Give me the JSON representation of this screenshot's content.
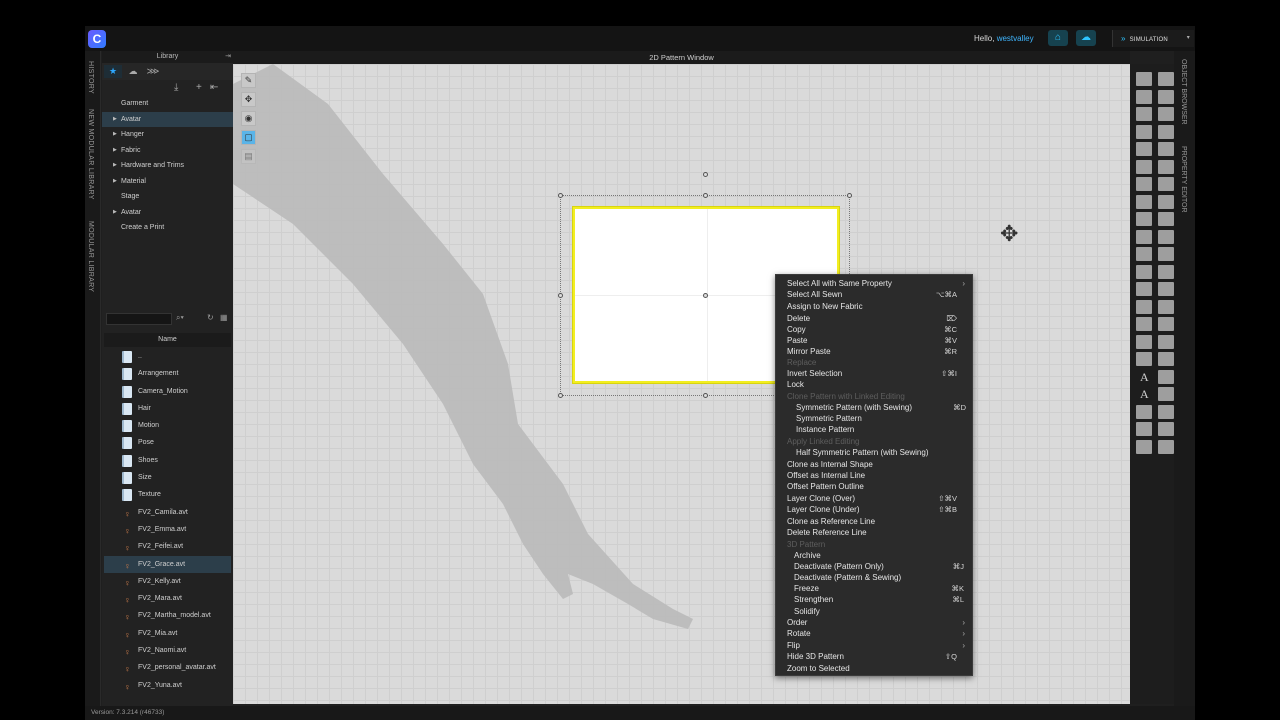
{
  "topbar": {
    "greeting": "Hello,",
    "username": "westvalley",
    "simulation_label": "SIMULATION"
  },
  "left_tabs": [
    "HISTORY",
    "NEW MODULAR LIBRARY",
    "MODULAR LIBRARY"
  ],
  "right_tabs": [
    "OBJECT BROWSER",
    "PROPERTY EDITOR"
  ],
  "library": {
    "title": "Library",
    "tree": [
      {
        "label": "Garment",
        "arrow": false,
        "selected": false
      },
      {
        "label": "Avatar",
        "arrow": true,
        "selected": true
      },
      {
        "label": "Hanger",
        "arrow": true,
        "selected": false
      },
      {
        "label": "Fabric",
        "arrow": true,
        "selected": false
      },
      {
        "label": "Hardware and Trims",
        "arrow": true,
        "selected": false
      },
      {
        "label": "Material",
        "arrow": true,
        "selected": false
      },
      {
        "label": "Stage",
        "arrow": false,
        "selected": false
      },
      {
        "label": "Avatar",
        "arrow": true,
        "selected": false
      },
      {
        "label": "Create a Print",
        "arrow": false,
        "selected": false
      }
    ],
    "column_header": "Name",
    "files": [
      {
        "name": "..",
        "type": "folder"
      },
      {
        "name": "Arrangement",
        "type": "folder"
      },
      {
        "name": "Camera_Motion",
        "type": "folder"
      },
      {
        "name": "Hair",
        "type": "folder"
      },
      {
        "name": "Motion",
        "type": "folder"
      },
      {
        "name": "Pose",
        "type": "folder"
      },
      {
        "name": "Shoes",
        "type": "folder"
      },
      {
        "name": "Size",
        "type": "folder"
      },
      {
        "name": "Texture",
        "type": "folder"
      },
      {
        "name": "FV2_Camila.avt",
        "type": "avatar"
      },
      {
        "name": "FV2_Emma.avt",
        "type": "avatar"
      },
      {
        "name": "FV2_Feifei.avt",
        "type": "avatar"
      },
      {
        "name": "FV2_Grace.avt",
        "type": "avatar",
        "selected": true
      },
      {
        "name": "FV2_Kelly.avt",
        "type": "avatar"
      },
      {
        "name": "FV2_Mara.avt",
        "type": "avatar"
      },
      {
        "name": "FV2_Martha_model.avt",
        "type": "avatar"
      },
      {
        "name": "FV2_Mia.avt",
        "type": "avatar"
      },
      {
        "name": "FV2_Naomi.avt",
        "type": "avatar"
      },
      {
        "name": "FV2_personal_avatar.avt",
        "type": "avatar"
      },
      {
        "name": "FV2_Yuna.avt",
        "type": "avatar"
      }
    ]
  },
  "window_title": "2D Pattern Window",
  "status": {
    "version": "Version: 7.3.214 (r46733)"
  },
  "context_menu": [
    {
      "label": "Select All with Same Property",
      "shortcut": "",
      "submenu": true,
      "disabled": false,
      "indent": 0
    },
    {
      "label": "Select All Sewn",
      "shortcut": "⌥⌘A",
      "submenu": false,
      "disabled": false,
      "indent": 0
    },
    {
      "label": "Assign to New Fabric",
      "shortcut": "",
      "submenu": false,
      "disabled": false,
      "indent": 0
    },
    {
      "label": "Delete",
      "shortcut": "⌦",
      "submenu": false,
      "disabled": false,
      "indent": 0
    },
    {
      "label": "Copy",
      "shortcut": "⌘C",
      "submenu": false,
      "disabled": false,
      "indent": 0
    },
    {
      "label": "Paste",
      "shortcut": "⌘V",
      "submenu": false,
      "disabled": false,
      "indent": 0
    },
    {
      "label": "Mirror Paste",
      "shortcut": "⌘R",
      "submenu": false,
      "disabled": false,
      "indent": 0
    },
    {
      "label": "Replace",
      "shortcut": "",
      "submenu": false,
      "disabled": true,
      "indent": 0
    },
    {
      "label": "Invert Selection",
      "shortcut": "⇧⌘I",
      "submenu": false,
      "disabled": false,
      "indent": 0
    },
    {
      "label": "Lock",
      "shortcut": "",
      "submenu": false,
      "disabled": false,
      "indent": 0
    },
    {
      "label": "Clone Pattern with Linked Editing",
      "shortcut": "",
      "submenu": false,
      "disabled": true,
      "indent": 0
    },
    {
      "label": "Symmetric Pattern (with Sewing)",
      "shortcut": "⌘D",
      "submenu": false,
      "disabled": false,
      "indent": 1
    },
    {
      "label": "Symmetric Pattern",
      "shortcut": "",
      "submenu": false,
      "disabled": false,
      "indent": 1
    },
    {
      "label": "Instance Pattern",
      "shortcut": "",
      "submenu": false,
      "disabled": false,
      "indent": 1
    },
    {
      "label": "Apply Linked Editing",
      "shortcut": "",
      "submenu": false,
      "disabled": true,
      "indent": 0
    },
    {
      "label": "Half Symmetric Pattern (with Sewing)",
      "shortcut": "",
      "submenu": false,
      "disabled": false,
      "indent": 1
    },
    {
      "label": "Clone as Internal Shape",
      "shortcut": "",
      "submenu": false,
      "disabled": false,
      "indent": 0
    },
    {
      "label": "Offset as Internal Line",
      "shortcut": "",
      "submenu": false,
      "disabled": false,
      "indent": 0
    },
    {
      "label": "Offset Pattern Outline",
      "shortcut": "",
      "submenu": false,
      "disabled": false,
      "indent": 0
    },
    {
      "label": "Layer Clone (Over)",
      "shortcut": "⇧⌘V",
      "submenu": false,
      "disabled": false,
      "indent": 0
    },
    {
      "label": "Layer Clone (Under)",
      "shortcut": "⇧⌘B",
      "submenu": false,
      "disabled": false,
      "indent": 0
    },
    {
      "label": "Clone as Reference Line",
      "shortcut": "",
      "submenu": false,
      "disabled": false,
      "indent": 0
    },
    {
      "label": "Delete Reference Line",
      "shortcut": "",
      "submenu": false,
      "disabled": false,
      "indent": 0
    },
    {
      "label": "3D Pattern",
      "shortcut": "",
      "submenu": false,
      "disabled": true,
      "indent": 0
    },
    {
      "label": "Archive",
      "shortcut": "",
      "submenu": false,
      "disabled": false,
      "indent": 2
    },
    {
      "label": "Deactivate (Pattern Only)",
      "shortcut": "⌘J",
      "submenu": false,
      "disabled": false,
      "indent": 2
    },
    {
      "label": "Deactivate (Pattern & Sewing)",
      "shortcut": "",
      "submenu": false,
      "disabled": false,
      "indent": 2
    },
    {
      "label": "Freeze",
      "shortcut": "⌘K",
      "submenu": false,
      "disabled": false,
      "indent": 2
    },
    {
      "label": "Strengthen",
      "shortcut": "⌘L",
      "submenu": false,
      "disabled": false,
      "indent": 2
    },
    {
      "label": "Solidify",
      "shortcut": "",
      "submenu": false,
      "disabled": false,
      "indent": 2
    },
    {
      "label": "Order",
      "shortcut": "",
      "submenu": true,
      "disabled": false,
      "indent": 0
    },
    {
      "label": "Rotate",
      "shortcut": "",
      "submenu": true,
      "disabled": false,
      "indent": 0
    },
    {
      "label": "Flip",
      "shortcut": "",
      "submenu": true,
      "disabled": false,
      "indent": 0
    },
    {
      "label": "Hide 3D Pattern",
      "shortcut": "⇧Q",
      "submenu": false,
      "disabled": false,
      "indent": 0
    },
    {
      "label": "Zoom to Selected",
      "shortcut": "",
      "submenu": false,
      "disabled": false,
      "indent": 0
    }
  ],
  "colors": {
    "accent": "#2ea8ff",
    "selection_outline": "#f2ee20",
    "canvas_bg": "#dadada"
  }
}
